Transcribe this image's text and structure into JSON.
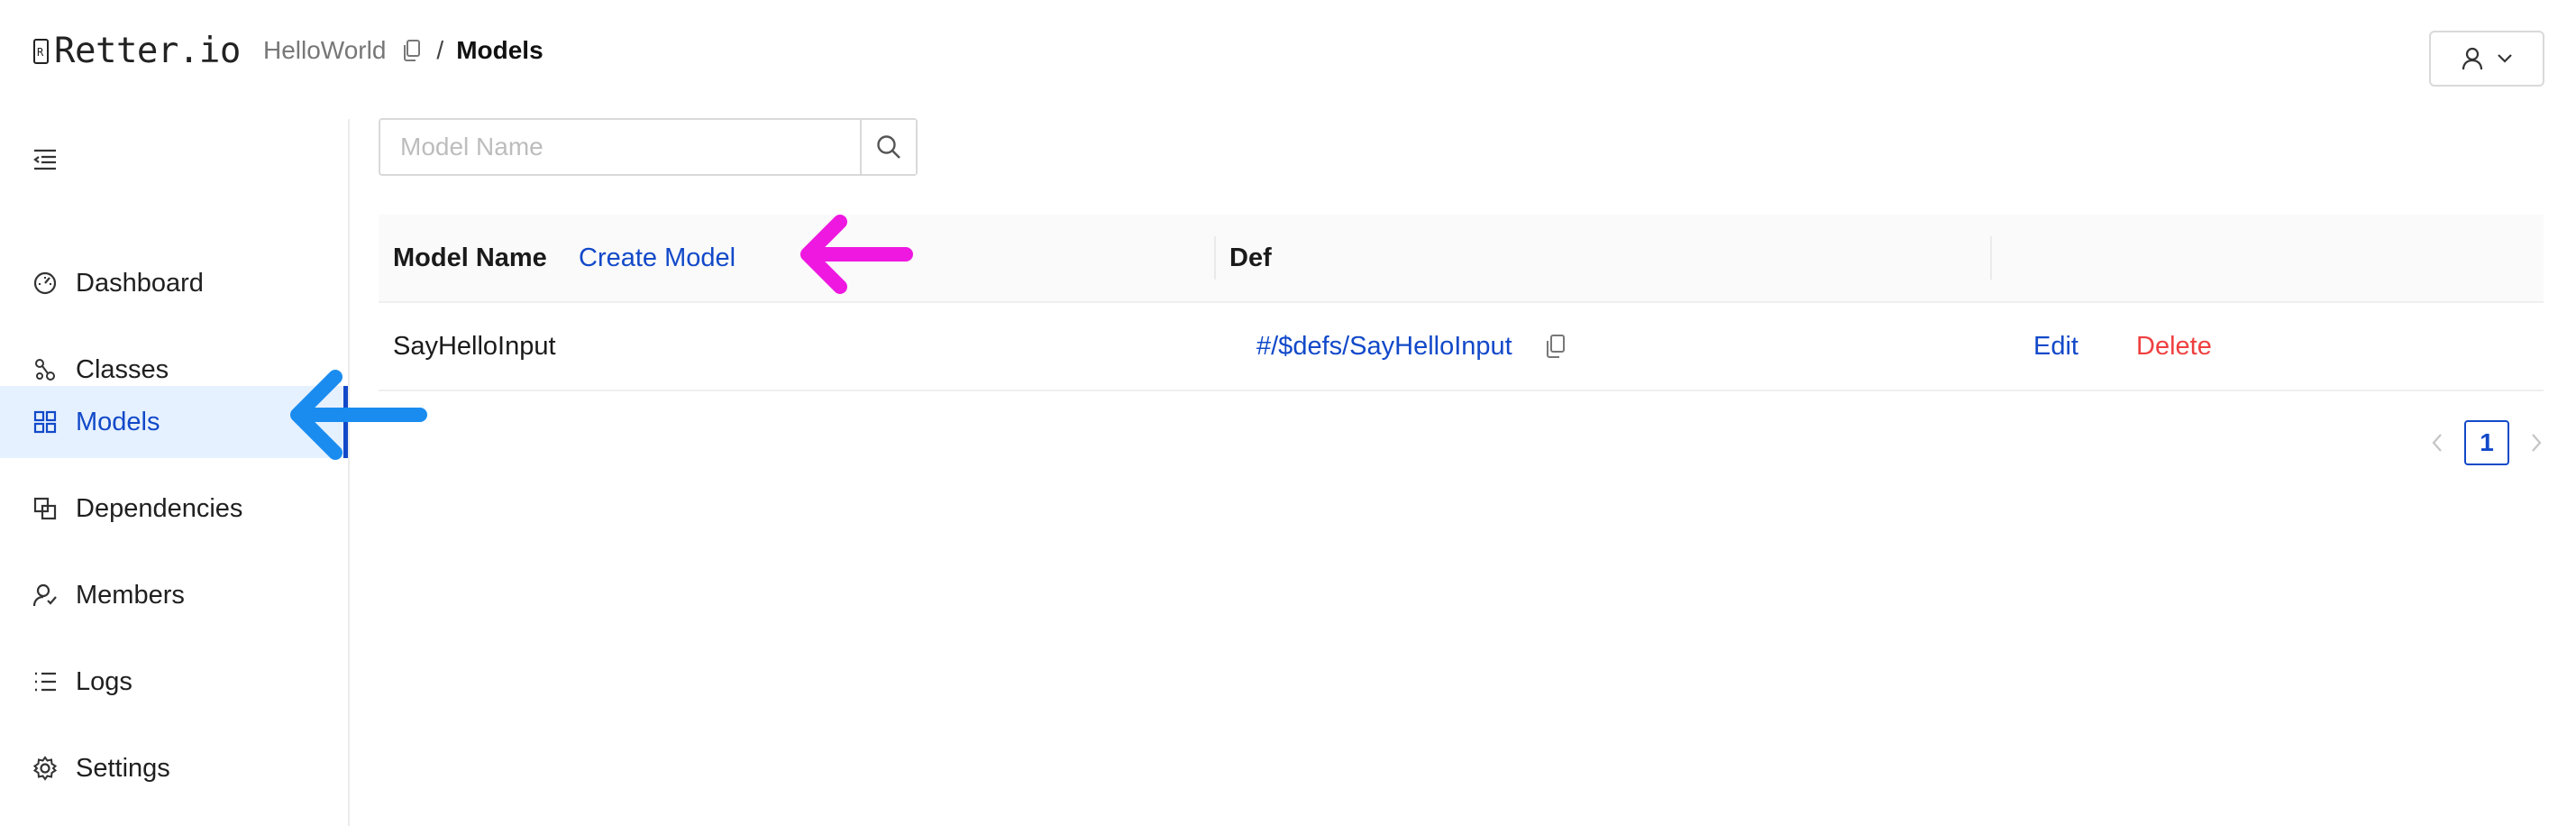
{
  "header": {
    "logo_text": "Retter.io",
    "breadcrumb": {
      "project": "HelloWorld",
      "separator": "/",
      "current": "Models"
    },
    "user_menu_icon": "user-icon"
  },
  "sidebar": {
    "collapse_icon": "menu-fold-icon",
    "items": [
      {
        "label": "Dashboard",
        "icon": "dashboard-icon",
        "active": false
      },
      {
        "label": "Classes",
        "icon": "classes-icon",
        "active": false
      },
      {
        "label": "Models",
        "icon": "grid-icon",
        "active": true
      },
      {
        "label": "Dependencies",
        "icon": "dependencies-icon",
        "active": false
      },
      {
        "label": "Members",
        "icon": "members-icon",
        "active": false
      },
      {
        "label": "Logs",
        "icon": "list-icon",
        "active": false
      },
      {
        "label": "Settings",
        "icon": "gear-icon",
        "active": false
      }
    ]
  },
  "search": {
    "placeholder": "Model Name",
    "value": ""
  },
  "table": {
    "columns": {
      "model_name": "Model Name",
      "create_model": "Create Model",
      "def": "Def"
    },
    "rows": [
      {
        "model_name": "SayHelloInput",
        "def": "#/$defs/SayHelloInput",
        "edit": "Edit",
        "delete": "Delete"
      }
    ]
  },
  "pagination": {
    "current_page": "1"
  },
  "colors": {
    "accent": "#1249c9",
    "danger": "#ef3f3f",
    "active_bg": "#e6f1ff",
    "annotation_magenta": "#ee18e0",
    "annotation_blue": "#1a8cf0"
  }
}
